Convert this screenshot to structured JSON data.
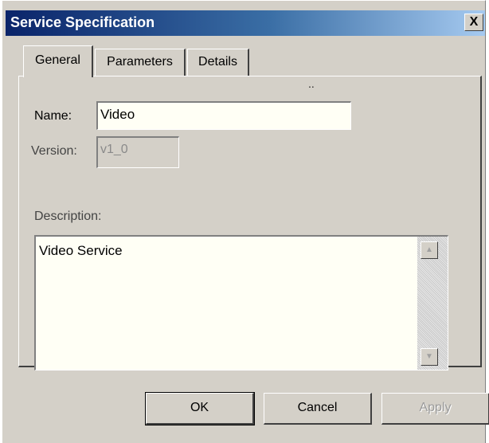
{
  "window": {
    "title": "Service Specification",
    "close_label": "X"
  },
  "tabs": [
    {
      "label": "General",
      "active": true
    },
    {
      "label": "Parameters",
      "active": false
    },
    {
      "label": "Details",
      "active": false
    }
  ],
  "general": {
    "name_label": "Name:",
    "name_value": "Video",
    "version_label": "Version:",
    "version_value": "v1_0",
    "description_label": "Description:",
    "description_value": "Video Service",
    "marker": ".."
  },
  "buttons": {
    "ok": "OK",
    "cancel": "Cancel",
    "apply": "Apply"
  },
  "colors": {
    "title_start": "#0a246a",
    "title_end": "#a6caf0",
    "face": "#d4d0c8"
  }
}
